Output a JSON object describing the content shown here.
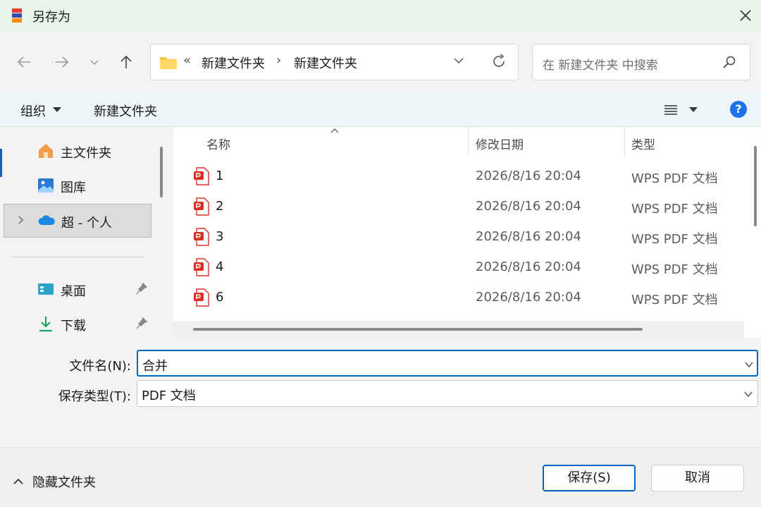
{
  "window": {
    "title": "另存为",
    "icons": {
      "app": "app-icon",
      "close": "close-icon"
    }
  },
  "nav": {
    "breadcrumb_overflow": "«",
    "breadcrumbs": [
      "新建文件夹",
      "新建文件夹"
    ],
    "separator": "›",
    "search_placeholder": "在 新建文件夹 中搜索"
  },
  "toolbar": {
    "organize_label": "组织",
    "new_folder_label": "新建文件夹",
    "help_label": "?"
  },
  "sidebar": {
    "items": [
      {
        "label": "主文件夹",
        "icon": "home-icon"
      },
      {
        "label": "图库",
        "icon": "gallery-icon"
      },
      {
        "label": "超 - 个人",
        "icon": "cloud-icon",
        "selected": true
      },
      {
        "label": "桌面",
        "icon": "desktop-icon",
        "pinned": true
      },
      {
        "label": "下载",
        "icon": "download-icon",
        "pinned": true
      }
    ]
  },
  "filelist": {
    "columns": [
      "名称",
      "修改日期",
      "类型"
    ],
    "rows": [
      {
        "name": "1",
        "date": "2026/8/16 20:04",
        "type": "WPS PDF 文档"
      },
      {
        "name": "2",
        "date": "2026/8/16 20:04",
        "type": "WPS PDF 文档"
      },
      {
        "name": "3",
        "date": "2026/8/16 20:04",
        "type": "WPS PDF 文档"
      },
      {
        "name": "4",
        "date": "2026/8/16 20:04",
        "type": "WPS PDF 文档"
      },
      {
        "name": "6",
        "date": "2026/8/16 20:04",
        "type": "WPS PDF 文档"
      }
    ]
  },
  "form": {
    "filename_label": "文件名(N):",
    "filename_value": "合并",
    "filetype_label": "保存类型(T):",
    "filetype_value": "PDF 文档"
  },
  "footer": {
    "hide_folders_label": "隐藏文件夹",
    "save_label": "保存(S)",
    "cancel_label": "取消"
  },
  "colors": {
    "accent": "#0067c0",
    "pdf_red": "#d93025",
    "titlebar": "#e6f4ea"
  }
}
